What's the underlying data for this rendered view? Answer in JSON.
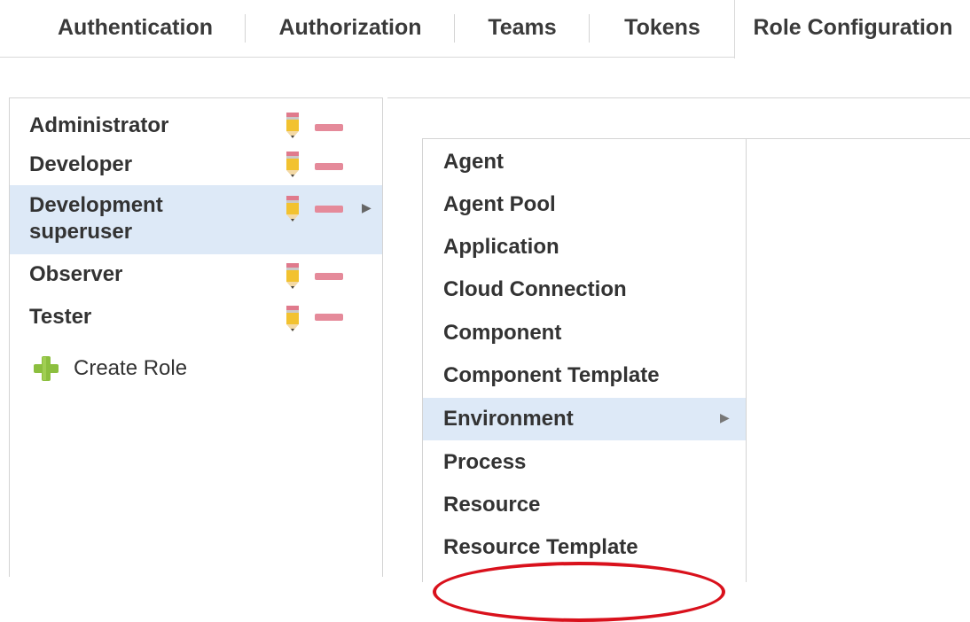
{
  "tabs": [
    {
      "label": "Authentication",
      "active": false
    },
    {
      "label": "Authorization",
      "active": false
    },
    {
      "label": "Teams",
      "active": false
    },
    {
      "label": "Tokens",
      "active": false
    },
    {
      "label": "Role Configuration",
      "active": true
    }
  ],
  "roles": [
    {
      "label": "Administrator",
      "selected": false
    },
    {
      "label": "Developer",
      "selected": false
    },
    {
      "label": "Development superuser",
      "selected": true
    },
    {
      "label": "Observer",
      "selected": false
    },
    {
      "label": "Tester",
      "selected": false
    }
  ],
  "create_role": {
    "label": "Create Role",
    "icon": "plus-icon"
  },
  "submenu": {
    "items": [
      {
        "label": "Agent"
      },
      {
        "label": "Agent Pool"
      },
      {
        "label": "Application"
      },
      {
        "label": "Cloud Connection"
      },
      {
        "label": "Component"
      },
      {
        "label": "Component Template"
      },
      {
        "label": "Environment",
        "active": true,
        "has_submenu": true
      },
      {
        "label": "Process"
      },
      {
        "label": "Resource"
      },
      {
        "label": "Resource Template"
      }
    ]
  },
  "colors": {
    "selected_bg": "#dde9f7",
    "delete_icon": "#e58a9a",
    "annotation_ring": "#d9111c",
    "plus_icon": "#8cbf3f"
  }
}
